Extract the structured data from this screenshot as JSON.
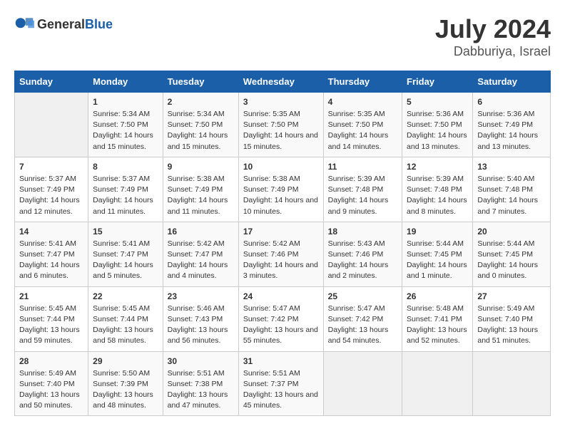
{
  "header": {
    "logo_general": "General",
    "logo_blue": "Blue",
    "title": "July 2024",
    "subtitle": "Dabburiya, Israel"
  },
  "days_of_week": [
    "Sunday",
    "Monday",
    "Tuesday",
    "Wednesday",
    "Thursday",
    "Friday",
    "Saturday"
  ],
  "weeks": [
    [
      {
        "day": null
      },
      {
        "day": "1",
        "sunrise": "Sunrise: 5:34 AM",
        "sunset": "Sunset: 7:50 PM",
        "daylight": "Daylight: 14 hours and 15 minutes."
      },
      {
        "day": "2",
        "sunrise": "Sunrise: 5:34 AM",
        "sunset": "Sunset: 7:50 PM",
        "daylight": "Daylight: 14 hours and 15 minutes."
      },
      {
        "day": "3",
        "sunrise": "Sunrise: 5:35 AM",
        "sunset": "Sunset: 7:50 PM",
        "daylight": "Daylight: 14 hours and 15 minutes."
      },
      {
        "day": "4",
        "sunrise": "Sunrise: 5:35 AM",
        "sunset": "Sunset: 7:50 PM",
        "daylight": "Daylight: 14 hours and 14 minutes."
      },
      {
        "day": "5",
        "sunrise": "Sunrise: 5:36 AM",
        "sunset": "Sunset: 7:50 PM",
        "daylight": "Daylight: 14 hours and 13 minutes."
      },
      {
        "day": "6",
        "sunrise": "Sunrise: 5:36 AM",
        "sunset": "Sunset: 7:49 PM",
        "daylight": "Daylight: 14 hours and 13 minutes."
      }
    ],
    [
      {
        "day": "7",
        "sunrise": "Sunrise: 5:37 AM",
        "sunset": "Sunset: 7:49 PM",
        "daylight": "Daylight: 14 hours and 12 minutes."
      },
      {
        "day": "8",
        "sunrise": "Sunrise: 5:37 AM",
        "sunset": "Sunset: 7:49 PM",
        "daylight": "Daylight: 14 hours and 11 minutes."
      },
      {
        "day": "9",
        "sunrise": "Sunrise: 5:38 AM",
        "sunset": "Sunset: 7:49 PM",
        "daylight": "Daylight: 14 hours and 11 minutes."
      },
      {
        "day": "10",
        "sunrise": "Sunrise: 5:38 AM",
        "sunset": "Sunset: 7:49 PM",
        "daylight": "Daylight: 14 hours and 10 minutes."
      },
      {
        "day": "11",
        "sunrise": "Sunrise: 5:39 AM",
        "sunset": "Sunset: 7:48 PM",
        "daylight": "Daylight: 14 hours and 9 minutes."
      },
      {
        "day": "12",
        "sunrise": "Sunrise: 5:39 AM",
        "sunset": "Sunset: 7:48 PM",
        "daylight": "Daylight: 14 hours and 8 minutes."
      },
      {
        "day": "13",
        "sunrise": "Sunrise: 5:40 AM",
        "sunset": "Sunset: 7:48 PM",
        "daylight": "Daylight: 14 hours and 7 minutes."
      }
    ],
    [
      {
        "day": "14",
        "sunrise": "Sunrise: 5:41 AM",
        "sunset": "Sunset: 7:47 PM",
        "daylight": "Daylight: 14 hours and 6 minutes."
      },
      {
        "day": "15",
        "sunrise": "Sunrise: 5:41 AM",
        "sunset": "Sunset: 7:47 PM",
        "daylight": "Daylight: 14 hours and 5 minutes."
      },
      {
        "day": "16",
        "sunrise": "Sunrise: 5:42 AM",
        "sunset": "Sunset: 7:47 PM",
        "daylight": "Daylight: 14 hours and 4 minutes."
      },
      {
        "day": "17",
        "sunrise": "Sunrise: 5:42 AM",
        "sunset": "Sunset: 7:46 PM",
        "daylight": "Daylight: 14 hours and 3 minutes."
      },
      {
        "day": "18",
        "sunrise": "Sunrise: 5:43 AM",
        "sunset": "Sunset: 7:46 PM",
        "daylight": "Daylight: 14 hours and 2 minutes."
      },
      {
        "day": "19",
        "sunrise": "Sunrise: 5:44 AM",
        "sunset": "Sunset: 7:45 PM",
        "daylight": "Daylight: 14 hours and 1 minute."
      },
      {
        "day": "20",
        "sunrise": "Sunrise: 5:44 AM",
        "sunset": "Sunset: 7:45 PM",
        "daylight": "Daylight: 14 hours and 0 minutes."
      }
    ],
    [
      {
        "day": "21",
        "sunrise": "Sunrise: 5:45 AM",
        "sunset": "Sunset: 7:44 PM",
        "daylight": "Daylight: 13 hours and 59 minutes."
      },
      {
        "day": "22",
        "sunrise": "Sunrise: 5:45 AM",
        "sunset": "Sunset: 7:44 PM",
        "daylight": "Daylight: 13 hours and 58 minutes."
      },
      {
        "day": "23",
        "sunrise": "Sunrise: 5:46 AM",
        "sunset": "Sunset: 7:43 PM",
        "daylight": "Daylight: 13 hours and 56 minutes."
      },
      {
        "day": "24",
        "sunrise": "Sunrise: 5:47 AM",
        "sunset": "Sunset: 7:42 PM",
        "daylight": "Daylight: 13 hours and 55 minutes."
      },
      {
        "day": "25",
        "sunrise": "Sunrise: 5:47 AM",
        "sunset": "Sunset: 7:42 PM",
        "daylight": "Daylight: 13 hours and 54 minutes."
      },
      {
        "day": "26",
        "sunrise": "Sunrise: 5:48 AM",
        "sunset": "Sunset: 7:41 PM",
        "daylight": "Daylight: 13 hours and 52 minutes."
      },
      {
        "day": "27",
        "sunrise": "Sunrise: 5:49 AM",
        "sunset": "Sunset: 7:40 PM",
        "daylight": "Daylight: 13 hours and 51 minutes."
      }
    ],
    [
      {
        "day": "28",
        "sunrise": "Sunrise: 5:49 AM",
        "sunset": "Sunset: 7:40 PM",
        "daylight": "Daylight: 13 hours and 50 minutes."
      },
      {
        "day": "29",
        "sunrise": "Sunrise: 5:50 AM",
        "sunset": "Sunset: 7:39 PM",
        "daylight": "Daylight: 13 hours and 48 minutes."
      },
      {
        "day": "30",
        "sunrise": "Sunrise: 5:51 AM",
        "sunset": "Sunset: 7:38 PM",
        "daylight": "Daylight: 13 hours and 47 minutes."
      },
      {
        "day": "31",
        "sunrise": "Sunrise: 5:51 AM",
        "sunset": "Sunset: 7:37 PM",
        "daylight": "Daylight: 13 hours and 45 minutes."
      },
      {
        "day": null
      },
      {
        "day": null
      },
      {
        "day": null
      }
    ]
  ]
}
